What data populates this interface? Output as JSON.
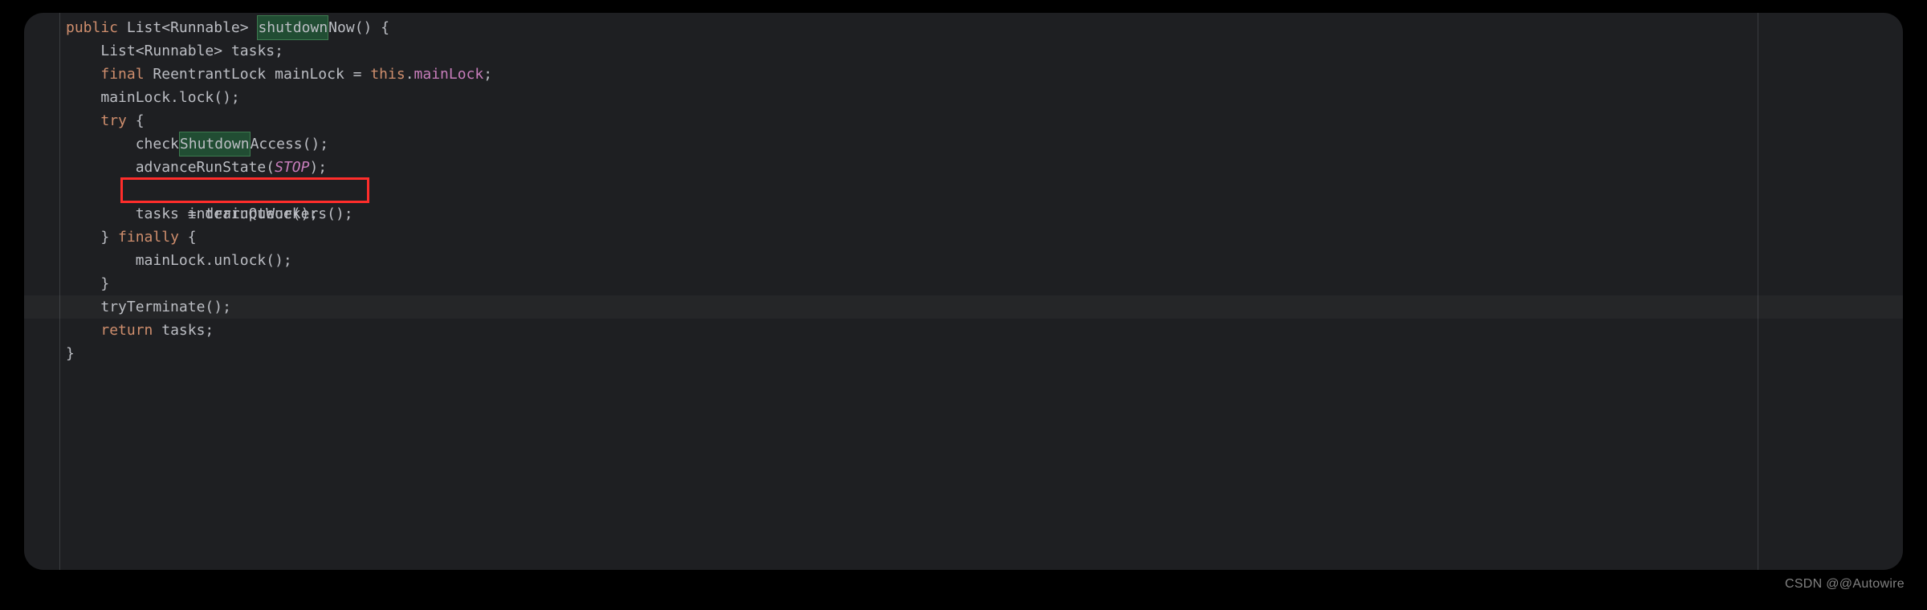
{
  "code": {
    "line1": {
      "kw_public": "public",
      "type1": "List",
      "lt": "<",
      "type2": "Runnable",
      "gt": ">",
      "sp": " ",
      "method_p1": "shutdown",
      "method_p2": "Now",
      "rest": "() {"
    },
    "line2": {
      "indent": "    ",
      "type1": "List",
      "lt": "<",
      "type2": "Runnable",
      "gt": ">",
      "rest": " tasks;"
    },
    "line3": {
      "indent": "    ",
      "kw_final": "final",
      "sp": " ",
      "type": "ReentrantLock",
      "sp2": " ",
      "var": "mainLock = ",
      "kw_this": "this",
      "dot": ".",
      "field": "mainLock",
      "semi": ";"
    },
    "line4": {
      "indent": "    ",
      "text": "mainLock.lock();"
    },
    "line5": {
      "indent": "    ",
      "kw": "try",
      "rest": " {"
    },
    "line6": {
      "indent": "        ",
      "p1": "check",
      "p2": "Shutdown",
      "p3": "Access();"
    },
    "line7": {
      "indent": "        ",
      "call": "advanceRunState(",
      "param": "STOP",
      "rest": ");"
    },
    "line8": {
      "indent": "        ",
      "text": "interruptWorkers();"
    },
    "line9": {
      "indent": "        ",
      "text": "tasks = drainQueue();"
    },
    "line10": {
      "indent": "    ",
      "brace": "} ",
      "kw": "finally",
      "rest": " {"
    },
    "line11": {
      "indent": "        ",
      "text": "mainLock.unlock();"
    },
    "line12": {
      "indent": "    ",
      "text": "}"
    },
    "line13": {
      "indent": "    ",
      "text": "tryTerminate();"
    },
    "line14": {
      "indent": "    ",
      "kw": "return",
      "rest": " tasks;"
    },
    "line15": {
      "text": "}"
    }
  },
  "watermark": "CSDN @@Autowire"
}
